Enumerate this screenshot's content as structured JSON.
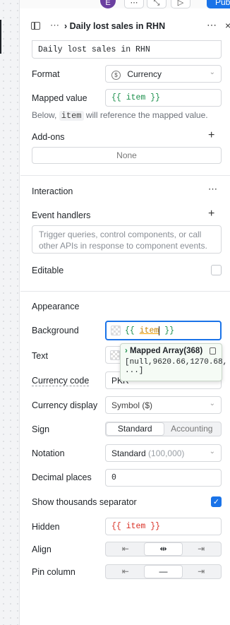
{
  "topbar": {
    "avatar_initial": "E",
    "publish_label": "Publish"
  },
  "header": {
    "title": "Daily lost sales in RHN"
  },
  "column": {
    "label_value": "Daily lost sales in RHN",
    "format_label": "Format",
    "format_value": "Currency",
    "mapped_value_label": "Mapped value",
    "mapped_value_code": "{{ item }}",
    "hint_before": "Below, ",
    "hint_code": "item",
    "hint_after": " will reference the mapped value.",
    "addons_label": "Add-ons",
    "addons_value": "None"
  },
  "interaction": {
    "title": "Interaction",
    "event_handlers_label": "Event handlers",
    "event_handlers_placeholder": "Trigger queries, control components, or call other APIs in response to component events.",
    "editable_label": "Editable",
    "editable_checked": false
  },
  "appearance": {
    "title": "Appearance",
    "background_label": "Background",
    "background_open": "{{ ",
    "background_item": "item",
    "background_close": " }}",
    "text_label": "Text",
    "currency_code_label": "Currency code",
    "currency_code_value": "PKR",
    "currency_display_label": "Currency display",
    "currency_display_value": "Symbol ($)",
    "sign_label": "Sign",
    "sign_options": [
      "Standard",
      "Accounting"
    ],
    "sign_selected": "Standard",
    "notation_label": "Notation",
    "notation_value": "Standard",
    "notation_hint": "(100,000)",
    "decimal_places_label": "Decimal places",
    "decimal_places_value": "0",
    "thousands_label": "Show thousands separator",
    "thousands_checked": true,
    "hidden_label": "Hidden",
    "hidden_value": "{{ item }}",
    "align_label": "Align",
    "align_options": [
      "left",
      "center",
      "right"
    ],
    "align_selected": "center",
    "pin_label": "Pin column",
    "pin_options": [
      "left",
      "none",
      "right"
    ],
    "pin_selected": "none"
  },
  "popup": {
    "title": "Mapped Array(368)",
    "value": "[null,9620.66,1270.68, ...]"
  }
}
